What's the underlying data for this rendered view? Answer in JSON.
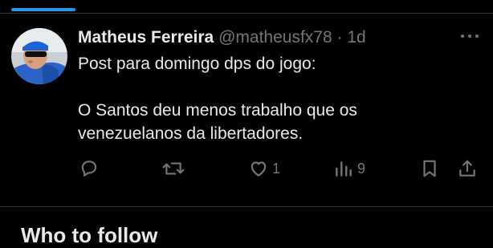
{
  "tweet": {
    "display_name": "Matheus Ferreira",
    "handle": "@matheusfx78",
    "separator": "·",
    "time": "1d",
    "text_lines": [
      "Post para domingo dps do jogo:",
      "",
      "O Santos deu menos trabalho que os",
      "venezuelanos da libertadores."
    ],
    "actions": {
      "reply": {
        "icon": "reply-icon",
        "count": ""
      },
      "retweet": {
        "icon": "retweet-icon",
        "count": ""
      },
      "like": {
        "icon": "heart-icon",
        "count": "1"
      },
      "views": {
        "icon": "views-icon",
        "count": "9"
      },
      "bookmark": {
        "icon": "bookmark-icon",
        "count": ""
      },
      "share": {
        "icon": "share-icon",
        "count": ""
      }
    }
  },
  "next_section": {
    "heading": "Who to follow"
  },
  "colors": {
    "background": "#000000",
    "text_primary": "#e7e9ea",
    "text_secondary": "#71767b",
    "accent": "#1d9bf0",
    "divider": "#2f3336"
  }
}
